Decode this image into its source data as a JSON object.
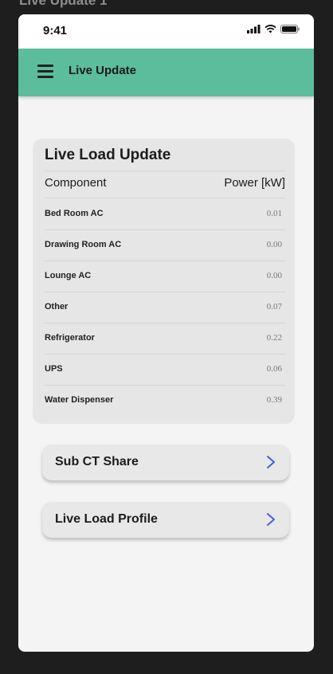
{
  "frame_label": "Live Update 1",
  "statusbar": {
    "time": "9:41"
  },
  "appbar": {
    "title": "Live Update"
  },
  "card": {
    "title": "Live Load Update",
    "columns": {
      "component": "Component",
      "power": "Power [kW]"
    },
    "rows": [
      {
        "label": "Bed Room AC",
        "value": "0.01"
      },
      {
        "label": "Drawing Room AC",
        "value": "0.00"
      },
      {
        "label": "Lounge AC",
        "value": "0.00"
      },
      {
        "label": "Other",
        "value": "0.07"
      },
      {
        "label": "Refrigerator",
        "value": "0.22"
      },
      {
        "label": "UPS",
        "value": "0.06"
      },
      {
        "label": "Water Dispenser",
        "value": "0.39"
      }
    ]
  },
  "buttons": {
    "sub_ct_share": "Sub CT Share",
    "live_load_profile": "Live Load Profile"
  },
  "colors": {
    "accent": "#5bbd9c",
    "chevron": "#4a5fd1"
  },
  "icons": {
    "menu": "hamburger-menu-icon",
    "signal": "signal-icon",
    "wifi": "wifi-icon",
    "battery": "battery-icon",
    "chevron": "chevron-right-icon"
  }
}
